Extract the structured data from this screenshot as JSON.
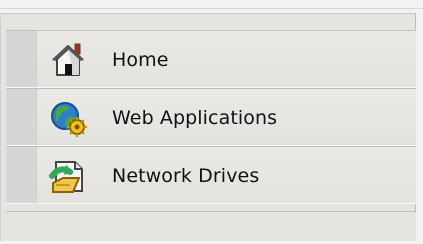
{
  "nav": {
    "items": [
      {
        "label": "Home",
        "icon": "home-icon"
      },
      {
        "label": "Web Applications",
        "icon": "web-applications-icon"
      },
      {
        "label": "Network Drives",
        "icon": "network-drives-icon"
      }
    ]
  }
}
